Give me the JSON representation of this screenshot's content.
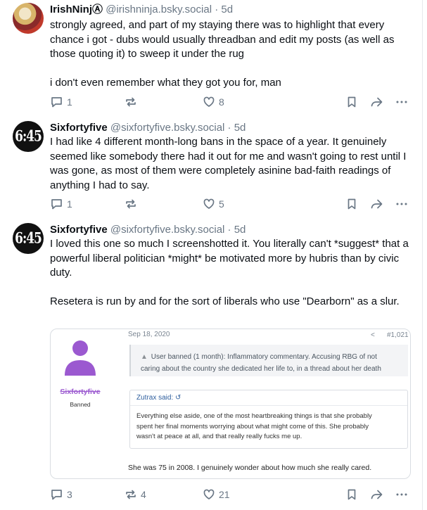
{
  "posts": [
    {
      "author_name": "IrishNinjⒶ",
      "handle": "@irishninja.bsky.social",
      "age": "5d",
      "paragraphs": [
        "strongly agreed, and part of my staying there was to highlight that every chance i got - dubs would usually threadban and edit my posts (as well as those quoting it) to sweep it under the rug",
        "i don't even remember what they got you for, man"
      ],
      "replies": "1",
      "reposts": "",
      "likes": "8"
    },
    {
      "author_name": "Sixfortyfive",
      "handle": "@sixfortyfive.bsky.social",
      "age": "5d",
      "avatar_text": "6:45",
      "paragraphs": [
        "I had like 4 different month-long bans in the space of a year. It genuinely seemed like somebody there had it out for me and wasn't going to rest until I was gone, as most of them were completely asinine bad-faith readings of anything I had to say."
      ],
      "replies": "1",
      "reposts": "",
      "likes": "5"
    },
    {
      "author_name": "Sixfortyfive",
      "handle": "@sixfortyfive.bsky.social",
      "age": "5d",
      "avatar_text": "6:45",
      "paragraphs": [
        "I loved this one so much I screenshotted it. You literally can't *suggest* that a powerful liberal politician *might* be motivated more by hubris than by civic duty.",
        "Resetera is run by and for the sort of liberals who use \"Dearborn\" as a slur."
      ],
      "replies": "3",
      "reposts": "4",
      "likes": "21"
    }
  ],
  "embed": {
    "date": "Sep 18, 2020",
    "post_number": "#1,021",
    "user_name": "Sixfortyfive",
    "user_status": "Banned",
    "ban_line1": "User banned (1 month): Inflammatory commentary. Accusing RBG of not",
    "ban_line2": "caring about the country she dedicated her life to, in a thread about her death",
    "quote_author": "Zutrax said:",
    "quote_line1": "Everything else aside, one of the most heartbreaking things is that she probably",
    "quote_line2": "spent her final moments worrying about what might come of this. She probably",
    "quote_line3": "wasn't at peace at all, and that really really fucks me up.",
    "reply": "She was 75 in 2008. I genuinely wonder about how much she really cared."
  },
  "icons": [
    "reply-icon",
    "repost-icon",
    "like-icon",
    "bookmark-icon",
    "share-icon",
    "more-icon"
  ],
  "colors": {
    "muted": "#6a7785",
    "banned_name": "#9b59d0",
    "quote_link": "#2f5f9e"
  }
}
